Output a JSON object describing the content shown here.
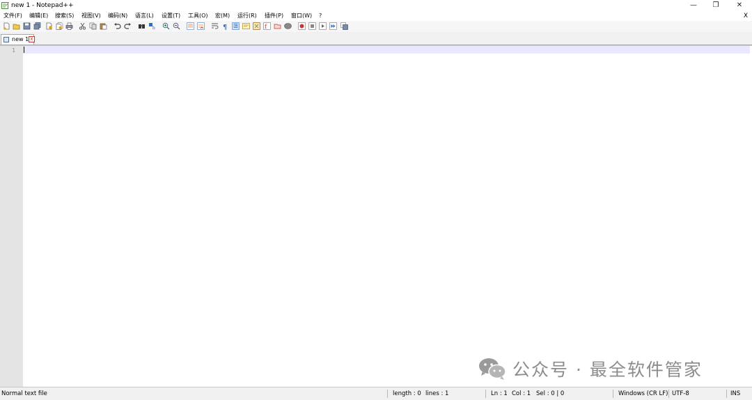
{
  "window": {
    "title": "new 1 - Notepad++",
    "minimize_glyph": "—",
    "maximize_glyph": "❐",
    "close_glyph": "✕"
  },
  "menubar": {
    "items": [
      "文件(F)",
      "编辑(E)",
      "搜索(S)",
      "视图(V)",
      "编码(N)",
      "语言(L)",
      "设置(T)",
      "工具(O)",
      "宏(M)",
      "运行(R)",
      "插件(P)",
      "窗口(W)",
      "?"
    ],
    "close_label": "X"
  },
  "tabs": [
    {
      "label": "new 1",
      "icon": "floppy-disk-icon",
      "close_glyph": "x"
    }
  ],
  "editor": {
    "line_numbers": [
      "1"
    ],
    "content": ""
  },
  "watermark": {
    "text": "公众号 · 最全软件管家",
    "icon": "wechat-icon"
  },
  "statusbar": {
    "file_type": "Normal text file",
    "length": "length : 0",
    "lines": "lines : 1",
    "ln": "Ln : 1",
    "col": "Col : 1",
    "sel": "Sel : 0 | 0",
    "eol": "Windows (CR LF)",
    "encoding": "UTF-8",
    "mode": "INS"
  },
  "colors": {
    "accent": "#7ea6d8",
    "current_line": "#e8e8ff",
    "gutter": "#e4e4e4",
    "tab_close": "#c0392b"
  }
}
